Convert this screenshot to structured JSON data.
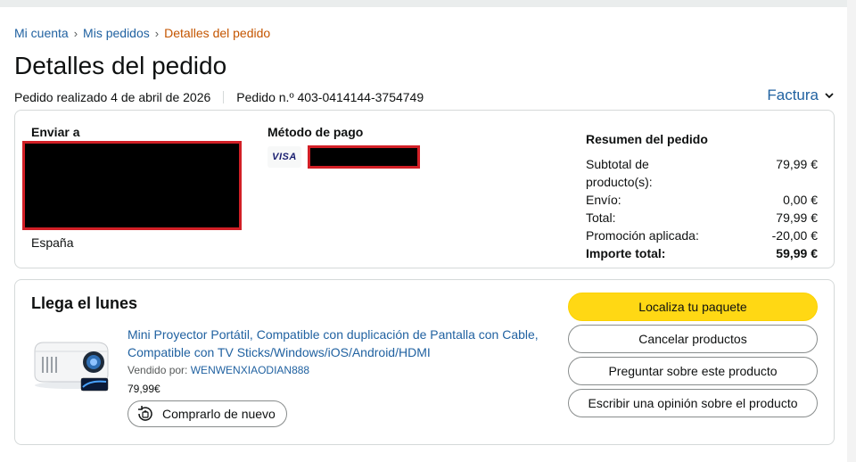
{
  "breadcrumb": {
    "items": [
      {
        "label": "Mi cuenta"
      },
      {
        "label": "Mis pedidos"
      }
    ],
    "current": "Detalles del pedido",
    "separator": "›"
  },
  "page": {
    "title": "Detalles del pedido",
    "order_placed": "Pedido realizado 4 de abril de 2026",
    "order_number": "Pedido n.º 403-0414144-3754749",
    "invoice_label": "Factura"
  },
  "shipping": {
    "heading": "Enviar a",
    "country": "España"
  },
  "payment": {
    "heading": "Método de pago",
    "card_brand": "VISA"
  },
  "summary": {
    "heading": "Resumen del pedido",
    "rows": [
      {
        "label": "Subtotal de producto(s):",
        "value": "79,99 €"
      },
      {
        "label": "Envío:",
        "value": "0,00 €"
      },
      {
        "label": "Total:",
        "value": "79,99 €"
      },
      {
        "label": "Promoción aplicada:",
        "value": "-20,00 €"
      },
      {
        "label": "Importe total:",
        "value": "59,99 €"
      }
    ]
  },
  "shipment": {
    "arrival": "Llega el lunes",
    "product_title": "Mini Proyector Portátil, Compatible con duplicación de Pantalla con Cable, Compatible con TV Sticks/Windows/iOS/Android/HDMI",
    "sold_by_label": "Vendido por:",
    "seller": "WENWENXIAODIAN888",
    "price": "79,99€",
    "rebuy_label": "Comprarlo de nuevo"
  },
  "actions": {
    "track": "Localiza tu paquete",
    "cancel": "Cancelar productos",
    "ask": "Preguntar sobre este producto",
    "review": "Escribir una opinión sobre el producto"
  },
  "colors": {
    "link": "#2162a1",
    "breadcrumb_current": "#c45500",
    "primary_button": "#ffd814",
    "border": "#d5d9d9",
    "redaction_border": "#d21f26"
  }
}
